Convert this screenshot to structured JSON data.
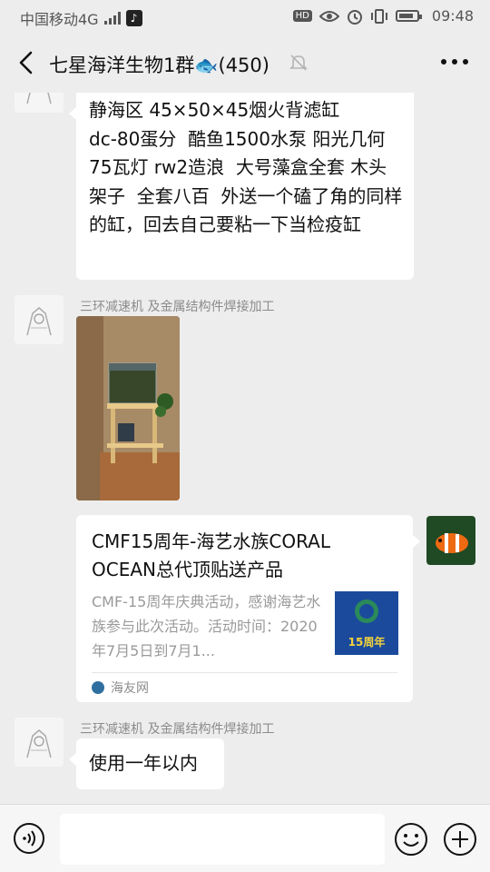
{
  "status_bar": {
    "carrier": "中国移动4G",
    "network": "4G",
    "hd": "HD",
    "time": "09:48"
  },
  "header": {
    "title": "七星海洋生物1群🐟(450)",
    "icons": [
      "back-icon",
      "mute-bell-icon",
      "more-icon"
    ]
  },
  "messages": [
    {
      "type": "text",
      "side": "left",
      "text": "静海区 45×50×45烟火背滤缸\ndc-80蛋分  酷鱼1500水泵 阳光几何75瓦灯 rw2造浪  大号藻盒全套 木头架子  全套八百  外送一个磕了角的同样的缸，回去自己要粘一下当检疫缸"
    },
    {
      "type": "image",
      "side": "left",
      "sender": "三环减速机 及金属结构件焊接加工",
      "alt": "aquarium-on-wooden-stand"
    },
    {
      "type": "link-card",
      "side": "right",
      "title": "CMF15周年-海艺水族CORAL OCEAN总代顶贴送产品",
      "description": "CMF-15周年庆典活动，感谢海艺水族参与此次活动。活动时间：2020年7月5日到7月1...",
      "thumb_label": "15周年",
      "source": "海友网"
    },
    {
      "type": "text",
      "side": "left",
      "sender": "三环减速机 及金属结构件焊接加工",
      "text": "使用一年以内"
    }
  ],
  "input_bar": {
    "icons": [
      "voice-icon",
      "emoji-icon",
      "plus-icon"
    ]
  },
  "colors": {
    "background": "#ededed",
    "bubble": "#ffffff",
    "sender": "#8c8c8c"
  }
}
